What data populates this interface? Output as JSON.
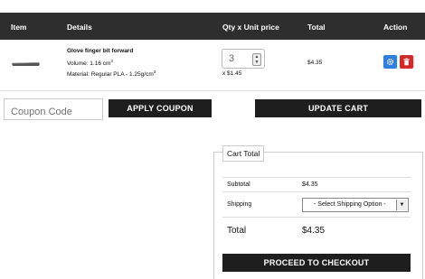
{
  "table_header": {
    "item": "Item",
    "details": "Details",
    "qty_price": "Qty x Unit price",
    "total": "Total",
    "action": "Action"
  },
  "cart_item": {
    "name": "Glove finger bit forward",
    "volume_label": "Volume: 1.16 cm",
    "volume_sup": "3",
    "material_label": "Material: Regular PLA - 1.25g/cm",
    "material_sup": "3",
    "quantity": "3",
    "unit_price": "x $1.45",
    "total": "$4.35"
  },
  "coupon": {
    "placeholder": "Coupon Code",
    "apply_label": "APPLY COUPON"
  },
  "update_cart_label": "UPDATE CART",
  "cart_total": {
    "legend": "Cart Total",
    "subtotal_label": "Subtotal",
    "subtotal_value": "$4.35",
    "shipping_label": "Shipping",
    "shipping_option": "- Select Shipping Option -",
    "total_label": "Total",
    "total_value": "$4.35",
    "checkout_label": "PROCEED TO CHECKOUT"
  },
  "icons": {
    "settings": "gear-icon",
    "delete": "trash-icon"
  },
  "colors": {
    "header_bg": "#2e2e2e",
    "button_bg": "#1e1e1e",
    "settings_btn": "#2f7fe0",
    "delete_btn": "#d22a2a"
  }
}
